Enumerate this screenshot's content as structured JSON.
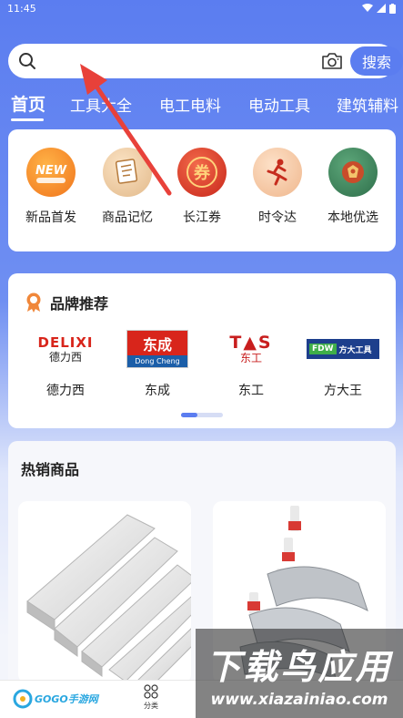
{
  "status_bar": {
    "time": "11:45"
  },
  "search": {
    "placeholder": "",
    "button_label": "搜索"
  },
  "tabs": [
    "首页",
    "工具大全",
    "电工电料",
    "电动工具",
    "建筑辅料"
  ],
  "quick_links": [
    {
      "label": "新品首发",
      "icon": "new-product-icon",
      "color": "#f08a24"
    },
    {
      "label": "商品记忆",
      "icon": "memory-notes-icon",
      "color": "#e9c9a0"
    },
    {
      "label": "长江券",
      "icon": "coupon-icon",
      "color": "#d93a24"
    },
    {
      "label": "时令达",
      "icon": "runner-icon",
      "color": "#f3c9a6"
    },
    {
      "label": "本地优选",
      "icon": "local-pick-icon",
      "color": "#3d8a5c"
    }
  ],
  "brands": {
    "title": "品牌推荐",
    "items": [
      {
        "label": "德力西",
        "logo_text": "DELIXI",
        "logo_sub": "德力西"
      },
      {
        "label": "东成",
        "logo_text": "东成",
        "logo_sub": "Dong Cheng"
      },
      {
        "label": "东工",
        "logo_text": "T▲S",
        "logo_sub": "东工"
      },
      {
        "label": "方大王",
        "logo_text": "FDW",
        "logo_sub": "方大工具"
      }
    ]
  },
  "hot_products": {
    "title": "热销商品"
  },
  "bottom_nav": {
    "category_label": "分类",
    "logo_text": "GOGO手游网"
  },
  "watermark": {
    "title": "下载鸟应用",
    "url": "www.xiazainiao.com"
  },
  "colors": {
    "primary": "#5b7df0",
    "arrow": "#e8413a"
  }
}
